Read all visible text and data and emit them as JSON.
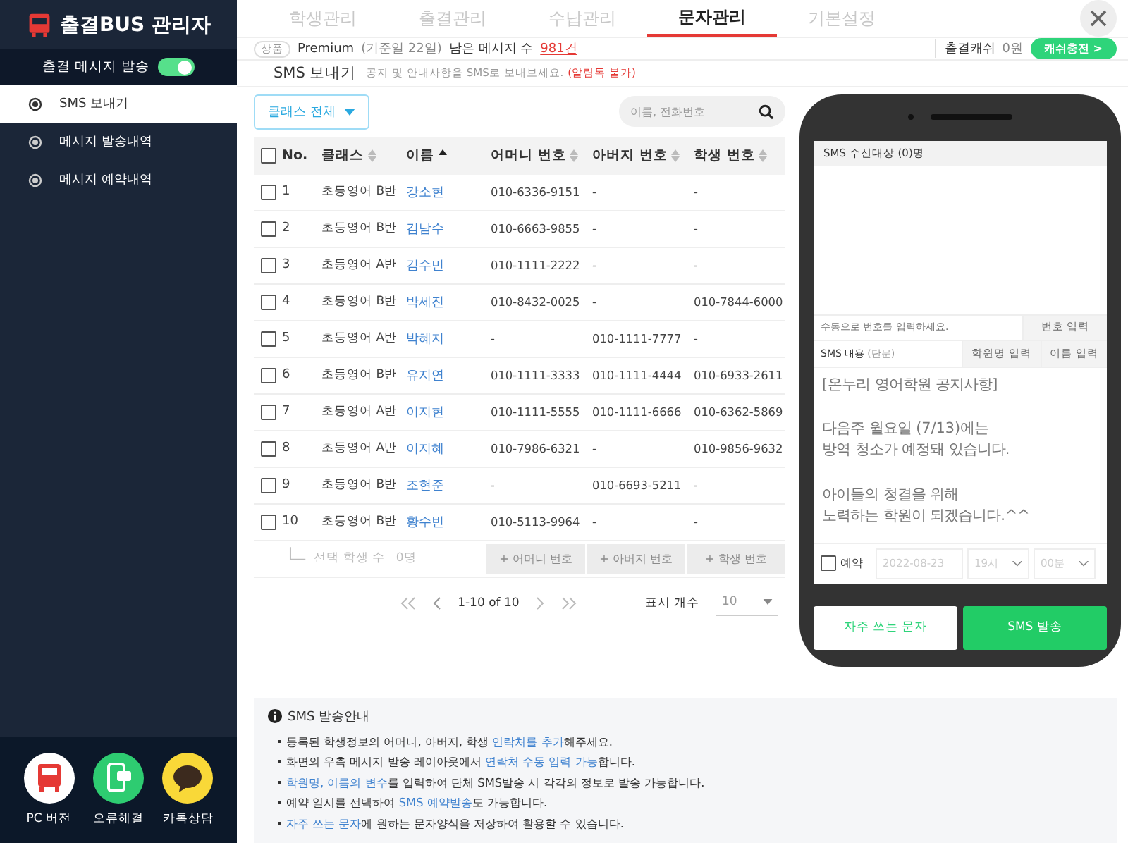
{
  "sidebar": {
    "logo": "출결BUS 관리자",
    "toggle": {
      "label": "출결 메시지 발송",
      "on": true
    },
    "items": [
      {
        "label": "SMS 보내기",
        "selected": true
      },
      {
        "label": "메시지 발송내역",
        "selected": false
      },
      {
        "label": "메시지 예약내역",
        "selected": false
      }
    ],
    "shortcuts": [
      {
        "label": "PC 버전",
        "kind": "bus",
        "color": "#ffffff"
      },
      {
        "label": "오류해결",
        "kind": "phone",
        "color": "#2ecc71"
      },
      {
        "label": "카톡상담",
        "kind": "chat",
        "color": "#f9d838"
      }
    ]
  },
  "tabs": [
    {
      "label": "학생관리",
      "selected": false
    },
    {
      "label": "출결관리",
      "selected": false
    },
    {
      "label": "수납관리",
      "selected": false
    },
    {
      "label": "문자관리",
      "selected": true
    },
    {
      "label": "기본설정",
      "selected": false
    }
  ],
  "info_bar": {
    "badge": "상품",
    "plan": "Premium",
    "plan_note": "(기준일 22일)",
    "remaining_label": "남은 메시지 수",
    "remaining": "981건",
    "cash_label": "출결캐쉬",
    "cash": "0원",
    "charge_button": "캐쉬충전 >"
  },
  "section": {
    "title": "SMS 보내기",
    "description": "공지 및 안내사항을 SMS로 보내보세요.",
    "warning": "(알림톡 불가)"
  },
  "filter": {
    "class_select": "클래스 전체",
    "search_placeholder": "이름, 전화번호"
  },
  "table": {
    "select_all_checked": false,
    "columns": [
      {
        "label": "No.",
        "kind": "plain"
      },
      {
        "label": "클래스",
        "kind": "sortable"
      },
      {
        "label": "이름",
        "kind": "sorted"
      },
      {
        "label": "어머니 번호",
        "kind": "sortable"
      },
      {
        "label": "아버지 번호",
        "kind": "sortable"
      },
      {
        "label": "학생 번호",
        "kind": "sortable"
      }
    ],
    "rows": [
      {
        "checked": false,
        "cells": [
          "1",
          "초등영어 B반",
          "강소현",
          "010-6336-9151",
          "-",
          "-"
        ]
      },
      {
        "checked": false,
        "cells": [
          "2",
          "초등영어 B반",
          "김남수",
          "010-6663-9855",
          "-",
          "-"
        ]
      },
      {
        "checked": false,
        "cells": [
          "3",
          "초등영어 A반",
          "김수민",
          "010-1111-2222",
          "-",
          "-"
        ]
      },
      {
        "checked": false,
        "cells": [
          "4",
          "초등영어 B반",
          "박세진",
          "010-8432-0025",
          "-",
          "010-7844-6000"
        ]
      },
      {
        "checked": false,
        "cells": [
          "5",
          "초등영어 A반",
          "박혜지",
          "-",
          "010-1111-7777",
          "-"
        ]
      },
      {
        "checked": false,
        "cells": [
          "6",
          "초등영어 B반",
          "유지연",
          "010-1111-3333",
          "010-1111-4444",
          "010-6933-2611"
        ]
      },
      {
        "checked": false,
        "cells": [
          "7",
          "초등영어 A반",
          "이지현",
          "010-1111-5555",
          "010-1111-6666",
          "010-6362-5869"
        ]
      },
      {
        "checked": false,
        "cells": [
          "8",
          "초등영어 A반",
          "이지혜",
          "010-7986-6321",
          "-",
          "010-9856-9632"
        ]
      },
      {
        "checked": false,
        "cells": [
          "9",
          "초등영어 B반",
          "조현준",
          "-",
          "010-6693-5211",
          "-"
        ]
      },
      {
        "checked": false,
        "cells": [
          "10",
          "초등영어 B반",
          "황수빈",
          "010-5113-9964",
          "-",
          "-"
        ]
      }
    ],
    "selection": {
      "label": "선택 학생 수",
      "count": "0명",
      "buttons": [
        "+ 어머니 번호",
        "+ 아버지 번호",
        "+ 학생 번호"
      ]
    }
  },
  "pagination": {
    "range": "1-10 of 10",
    "page_size_label": "표시 개수",
    "page_size": "10"
  },
  "phone": {
    "recipients_title": "SMS 수신대상 (0)명",
    "manual_placeholder": "수동으로 번호를 입력하세요.",
    "manual_button": "번호 입력",
    "content_label": "SMS 내용",
    "content_type": "(단문)",
    "insert_buttons": [
      "학원명 입력",
      "이름 입력"
    ],
    "message": "[온누리 영어학원 공지사항]\n\n다음주 월요일 (7/13)에는\n방역 청소가 예정돼 있습니다.\n\n아이들의 청결을 위해\n노력하는 학원이 되겠습니다.^^",
    "reserve": {
      "label": "예약",
      "checked": false,
      "date": "2022-08-23",
      "hour": "19시",
      "minute": "00분"
    },
    "frequent_button": "자주 쓰는 문자",
    "send_button": "SMS 발송"
  },
  "guide": {
    "title": "SMS 발송안내",
    "bullets": [
      [
        {
          "text": "등록된 학생정보의 어머니, 아버지, 학생 ",
          "highlight": false
        },
        {
          "text": "연락처를 추가",
          "highlight": true
        },
        {
          "text": "해주세요.",
          "highlight": false
        }
      ],
      [
        {
          "text": "화면의 우측 메시지 발송 레이아웃에서 ",
          "highlight": false
        },
        {
          "text": "연락처 수동 입력 가능",
          "highlight": true
        },
        {
          "text": "합니다.",
          "highlight": false
        }
      ],
      [
        {
          "text": "학원명, 이름의 변수",
          "highlight": true
        },
        {
          "text": "를 입력하여 단체 SMS발송 시 각각의 정보로 발송 가능합니다.",
          "highlight": false
        }
      ],
      [
        {
          "text": "예약 일시를 선택하여 ",
          "highlight": false
        },
        {
          "text": "SMS 예약발송",
          "highlight": true
        },
        {
          "text": "도 가능합니다.",
          "highlight": false
        }
      ],
      [
        {
          "text": "자주 쓰는 문자",
          "highlight": true
        },
        {
          "text": "에 원하는 문자양식을 저장하여 활용할 수 있습니다.",
          "highlight": false
        }
      ]
    ]
  }
}
